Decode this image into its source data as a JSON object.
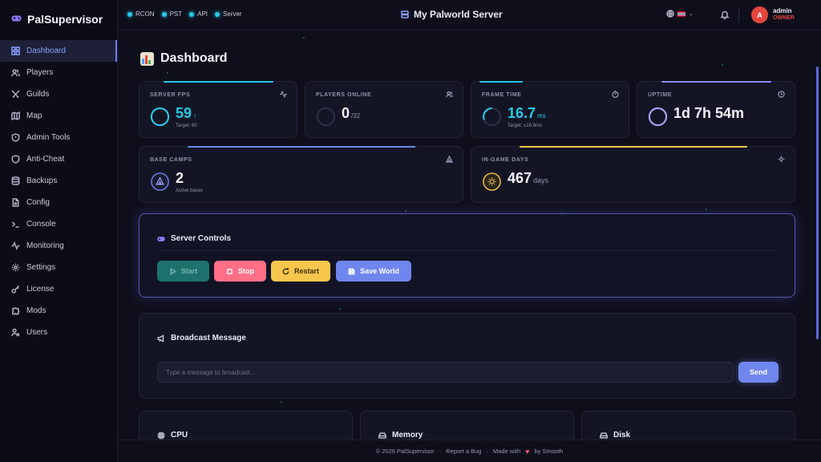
{
  "app": {
    "name": "PalSupervisor"
  },
  "sidebar": {
    "items": [
      {
        "label": "Dashboard",
        "icon": "grid-icon",
        "active": true
      },
      {
        "label": "Players",
        "icon": "users-icon"
      },
      {
        "label": "Guilds",
        "icon": "swords-icon"
      },
      {
        "label": "Map",
        "icon": "map-icon"
      },
      {
        "label": "Admin Tools",
        "icon": "shield-icon"
      },
      {
        "label": "Anti-Cheat",
        "icon": "shield-check-icon"
      },
      {
        "label": "Backups",
        "icon": "database-icon"
      },
      {
        "label": "Config",
        "icon": "file-icon"
      },
      {
        "label": "Console",
        "icon": "terminal-icon"
      },
      {
        "label": "Monitoring",
        "icon": "activity-icon"
      },
      {
        "label": "Settings",
        "icon": "gear-icon"
      },
      {
        "label": "License",
        "icon": "key-icon"
      },
      {
        "label": "Mods",
        "icon": "puzzle-icon"
      },
      {
        "label": "Users",
        "icon": "user-cog-icon"
      }
    ]
  },
  "topbar": {
    "statuses": [
      "RCON",
      "PST",
      "API",
      "Server"
    ],
    "server_title": "My Palworld Server",
    "user": {
      "initial": "A",
      "name": "admin",
      "role": "OWNER"
    }
  },
  "page": {
    "title": "Dashboard"
  },
  "stats": {
    "server_fps": {
      "label": "SERVER FPS",
      "value": "59",
      "arrow": "↑",
      "sub": "Target: 60"
    },
    "players_online": {
      "label": "PLAYERS ONLINE",
      "value": "0",
      "unit": "/32"
    },
    "frame_time": {
      "label": "FRAME TIME",
      "value": "16.7",
      "unit": "ms",
      "sub": "Target: ≤16.6ms"
    },
    "uptime": {
      "label": "UPTIME",
      "value": "1d 7h 54m"
    },
    "base_camps": {
      "label": "BASE CAMPS",
      "value": "2",
      "sub": "Active bases"
    },
    "ingame_days": {
      "label": "IN-GAME DAYS",
      "value": "467",
      "unit": "days"
    }
  },
  "controls": {
    "title": "Server Controls",
    "start": "Start",
    "stop": "Stop",
    "restart": "Restart",
    "save": "Save World"
  },
  "broadcast": {
    "title": "Broadcast Message",
    "placeholder": "Type a message to broadcast...",
    "send": "Send"
  },
  "resources": {
    "cpu": "CPU",
    "memory": "Memory",
    "disk": "Disk"
  },
  "footer": {
    "copyright": "© 2026 PalSupervisor",
    "sep": "·",
    "report": "Report a Bug",
    "made_with": "Made with",
    "heart": "♥",
    "by": "by Smooth"
  },
  "colors": {
    "accent": "#6f86ee",
    "cyan": "#27c9e6",
    "start": "#1f8a80",
    "stop": "#ff6f86",
    "restart": "#f7c64d",
    "save": "#6f86ee",
    "owner": "#e5453c"
  }
}
